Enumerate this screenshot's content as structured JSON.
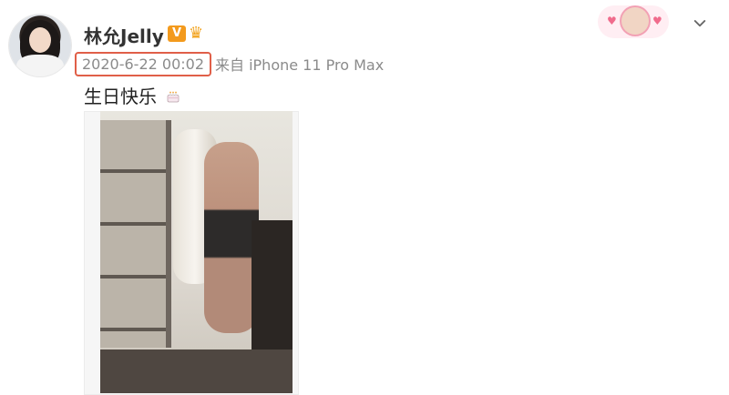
{
  "post": {
    "username": "林允Jelly",
    "verified_badge": "V",
    "timestamp": "2020-6-22 00:02",
    "source": "来自 iPhone 11 Pro Max",
    "text": "生日快乐",
    "icons": [
      "cake-icon",
      "crown-icon",
      "chevron-down-icon"
    ]
  },
  "colors": {
    "highlight_border": "#e05f48",
    "meta_text": "#8b8b8b",
    "badge_orange": "#f39a1d"
  }
}
